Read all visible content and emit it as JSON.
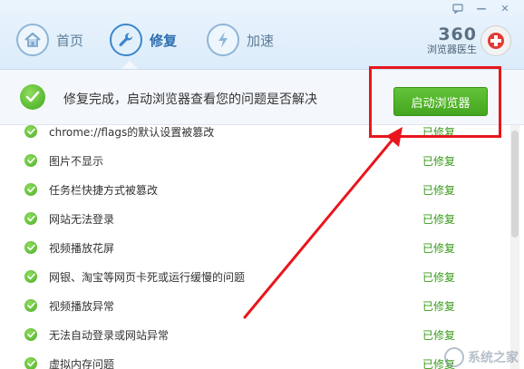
{
  "window": {
    "buttons": [
      {
        "name": "feedback-button",
        "icon": "speech-bubble-icon"
      },
      {
        "name": "minimize-button",
        "label": "—"
      },
      {
        "name": "close-button",
        "label": "✕"
      }
    ]
  },
  "nav": {
    "items": [
      {
        "label": "首页",
        "icon": "home-icon",
        "active": false
      },
      {
        "label": "修复",
        "icon": "wrench-icon",
        "active": true
      },
      {
        "label": "加速",
        "icon": "lightning-icon",
        "active": false
      }
    ]
  },
  "brand": {
    "number": "360",
    "subtitle": "浏览器医生",
    "badge_icon": "medical-cross-icon"
  },
  "status": {
    "message": "修复完成，启动浏览器查看您的问题是否解决",
    "launch_button": "启动浏览器"
  },
  "list": {
    "items": [
      {
        "text": "chrome://flags的默认设置被篡改",
        "status": "已修复"
      },
      {
        "text": "图片不显示",
        "status": "已修复"
      },
      {
        "text": "任务栏快捷方式被篡改",
        "status": "已修复"
      },
      {
        "text": "网站无法登录",
        "status": "已修复"
      },
      {
        "text": "视频播放花屏",
        "status": "已修复"
      },
      {
        "text": "网银、淘宝等网页卡死或运行缓慢的问题",
        "status": "已修复"
      },
      {
        "text": "视频播放异常",
        "status": "已修复"
      },
      {
        "text": "无法自动登录或网站异常",
        "status": "已修复"
      },
      {
        "text": "虚拟内存问题",
        "status": "已修复"
      }
    ]
  },
  "watermark": {
    "text": "系统之家"
  },
  "colors": {
    "accent": "#3b86cc",
    "success": "#3a9b1a",
    "button": "#4fb029",
    "highlight": "#e8161c"
  }
}
